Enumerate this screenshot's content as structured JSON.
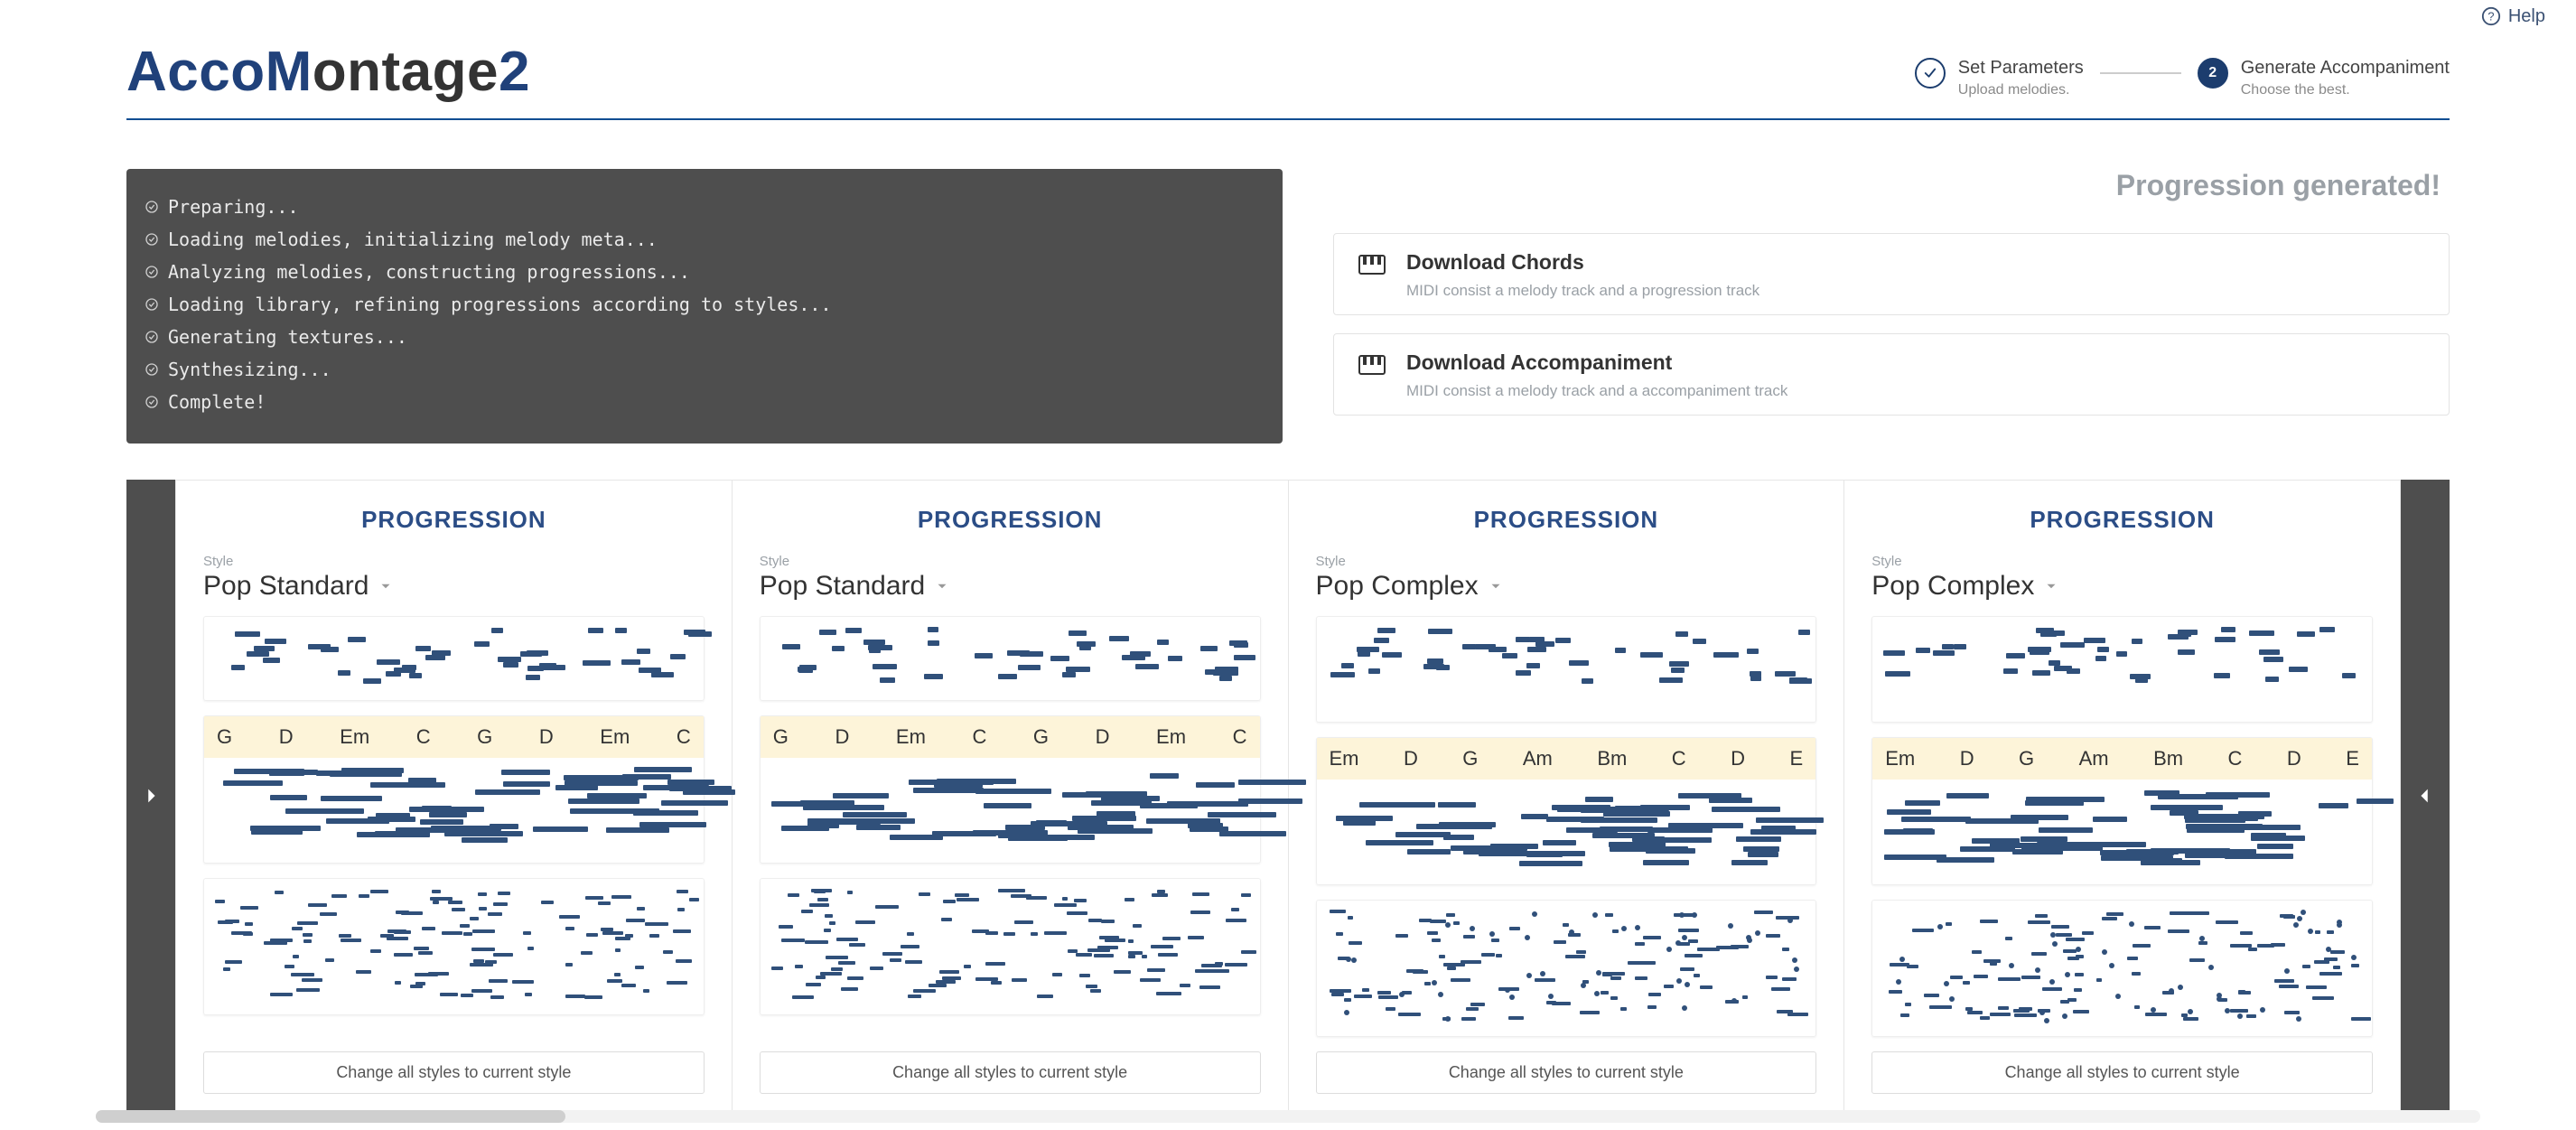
{
  "help_label": "Help",
  "logo": {
    "part1": "Acco",
    "part2": "M",
    "part3": "ontage",
    "part4": "2"
  },
  "steps": [
    {
      "title": "Set Parameters",
      "sub": "Upload melodies."
    },
    {
      "title": "Generate Accompaniment",
      "sub": "Choose the best."
    }
  ],
  "console": [
    "Preparing...",
    "Loading melodies, initializing melody meta...",
    "Analyzing melodies, constructing progressions...",
    "Loading library, refining progressions according to styles...",
    "Generating textures...",
    "Synthesizing...",
    "Complete!"
  ],
  "status": "Progression generated!",
  "downloads": [
    {
      "title": "Download Chords",
      "sub": "MIDI consist a melody track and a progression track"
    },
    {
      "title": "Download Accompaniment",
      "sub": "MIDI consist a melody track and a accompaniment track"
    }
  ],
  "card_title": "PROGRESSION",
  "style_label": "Style",
  "change_label": "Change all styles to current style",
  "cards": [
    {
      "style": "Pop Standard",
      "chords": [
        "G",
        "D",
        "Em",
        "C",
        "G",
        "D",
        "Em",
        "C"
      ]
    },
    {
      "style": "Pop Standard",
      "chords": [
        "G",
        "D",
        "Em",
        "C",
        "G",
        "D",
        "Em",
        "C"
      ]
    },
    {
      "style": "Pop Complex",
      "chords": [
        "Em",
        "D",
        "G",
        "Am",
        "Bm",
        "C",
        "D",
        "E"
      ]
    },
    {
      "style": "Pop Complex",
      "chords": [
        "Em",
        "D",
        "G",
        "Am",
        "Bm",
        "C",
        "D",
        "E"
      ]
    }
  ]
}
